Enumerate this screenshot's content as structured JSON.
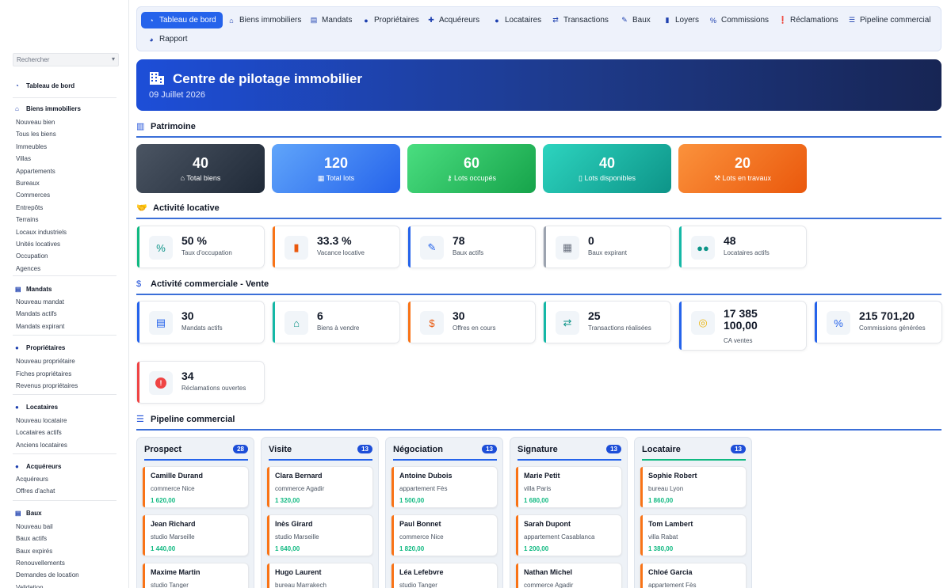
{
  "sidebar": {
    "search_placeholder": "Rechercher",
    "dashboard": "Tableau de bord",
    "groups": [
      {
        "title": "Biens immobiliers",
        "items": [
          "Nouveau bien",
          "Tous les biens",
          "Immeubles",
          "Villas",
          "Appartements",
          "Bureaux",
          "Commerces",
          "Entrepôts",
          "Terrains",
          "Locaux industriels",
          "Unités locatives",
          "Occupation",
          "Agences"
        ]
      },
      {
        "title": "Mandats",
        "items": [
          "Nouveau mandat",
          "Mandats actifs",
          "Mandats expirant"
        ]
      },
      {
        "title": "Propriétaires",
        "items": [
          "Nouveau propriétaire",
          "Fiches propriétaires",
          "Revenus propriétaires"
        ]
      },
      {
        "title": "Locataires",
        "items": [
          "Nouveau locataire",
          "Locataires actifs",
          "Anciens locataires"
        ]
      },
      {
        "title": "Acquéreurs",
        "items": [
          "Acquéreurs",
          "Offres d'achat"
        ]
      },
      {
        "title": "Baux",
        "items": [
          "Nouveau bail",
          "Baux actifs",
          "Baux expirés",
          "Renouvellements",
          "Demandes de location",
          "Validation"
        ]
      }
    ]
  },
  "nav": [
    "Tableau de bord",
    "Biens immobiliers",
    "Mandats",
    "Propriétaires",
    "Acquéreurs",
    "Locataires",
    "Transactions",
    "Baux",
    "Loyers",
    "Commissions",
    "Réclamations",
    "Pipeline commercial",
    "Rapport"
  ],
  "hero": {
    "title": "Centre de pilotage immobilier",
    "date": "09 Juillet 2026"
  },
  "sections": {
    "patrimoine": "Patrimoine",
    "locative": "Activité locative",
    "commerciale": "Activité commerciale - Vente",
    "pipeline": "Pipeline commercial"
  },
  "patrimoine": [
    {
      "value": "40",
      "label": "Total biens",
      "icon": "home-icon",
      "color": "#2d3748"
    },
    {
      "value": "120",
      "label": "Total lots",
      "icon": "grid-icon",
      "color": "#3b82f6"
    },
    {
      "value": "60",
      "label": "Lots occupés",
      "icon": "key-icon",
      "color": "#22c55e"
    },
    {
      "value": "40",
      "label": "Lots disponibles",
      "icon": "door-icon",
      "color": "#14b8a6"
    },
    {
      "value": "20",
      "label": "Lots en travaux",
      "icon": "wrench-icon",
      "color": "#f97316"
    }
  ],
  "locative": [
    {
      "value": "50 %",
      "label": "Taux d'occupation",
      "icon": "percent-icon",
      "bar": "#10b981"
    },
    {
      "value": "33.3 %",
      "label": "Vacance locative",
      "icon": "door-open-icon",
      "bar": "#f97316"
    },
    {
      "value": "78",
      "label": "Baux actifs",
      "icon": "signature-icon",
      "bar": "#2563eb"
    },
    {
      "value": "0",
      "label": "Baux expirant",
      "icon": "calendar-icon",
      "bar": "#9ca3af"
    },
    {
      "value": "48",
      "label": "Locataires actifs",
      "icon": "users-icon",
      "bar": "#14b8a6"
    }
  ],
  "commerciale": [
    {
      "value": "30",
      "label": "Mandats actifs",
      "icon": "contract-icon",
      "bar": "#2563eb"
    },
    {
      "value": "6",
      "label": "Biens à vendre",
      "icon": "house-icon",
      "bar": "#14b8a6"
    },
    {
      "value": "30",
      "label": "Offres en cours",
      "icon": "hand-money-icon",
      "bar": "#f97316"
    },
    {
      "value": "25",
      "label": "Transactions réalisées",
      "icon": "handshake-icon",
      "bar": "#14b8a6"
    },
    {
      "value": "17 385\n100,00",
      "label": "CA ventes",
      "icon": "coins-icon",
      "bar": "#2563eb"
    },
    {
      "value": "215 701,20",
      "label": "Commissions générées",
      "icon": "percent-icon",
      "bar": "#2563eb"
    },
    {
      "value": "34",
      "label": "Réclamations ouvertes",
      "icon": "alert-icon",
      "bar": "#ef4444"
    }
  ],
  "pipeline": [
    {
      "title": "Prospect",
      "count": "28",
      "underline": "#2563eb",
      "cards": [
        {
          "name": "Camille Durand",
          "desc": "commerce Nice",
          "price": "1 620,00",
          "bar": "#f97316"
        },
        {
          "name": "Jean Richard",
          "desc": "studio Marseille",
          "price": "1 440,00",
          "bar": "#f97316"
        },
        {
          "name": "Maxime Martin",
          "desc": "studio Tanger",
          "price": "",
          "bar": "#f97316"
        }
      ]
    },
    {
      "title": "Visite",
      "count": "13",
      "underline": "#2563eb",
      "cards": [
        {
          "name": "Clara Bernard",
          "desc": "commerce Agadir",
          "price": "1 320,00",
          "bar": "#f97316"
        },
        {
          "name": "Inès Girard",
          "desc": "studio Marseille",
          "price": "1 640,00",
          "bar": "#f97316"
        },
        {
          "name": "Hugo Laurent",
          "desc": "bureau Marrakech",
          "price": "",
          "bar": "#f97316"
        }
      ]
    },
    {
      "title": "Négociation",
      "count": "13",
      "underline": "#2563eb",
      "cards": [
        {
          "name": "Antoine Dubois",
          "desc": "appartement Fès",
          "price": "1 500,00",
          "bar": "#f97316"
        },
        {
          "name": "Paul Bonnet",
          "desc": "commerce Nice",
          "price": "1 820,00",
          "bar": "#f97316"
        },
        {
          "name": "Léa Lefebvre",
          "desc": "studio Tanger",
          "price": "",
          "bar": "#f97316"
        }
      ]
    },
    {
      "title": "Signature",
      "count": "13",
      "underline": "#2563eb",
      "cards": [
        {
          "name": "Marie Petit",
          "desc": "villa Paris",
          "price": "1 680,00",
          "bar": "#f97316"
        },
        {
          "name": "Sarah Dupont",
          "desc": "appartement Casablanca",
          "price": "1 200,00",
          "bar": "#f97316"
        },
        {
          "name": "Nathan Michel",
          "desc": "commerce Agadir",
          "price": "",
          "bar": "#f97316"
        }
      ]
    },
    {
      "title": "Locataire",
      "count": "13",
      "underline": "#10b981",
      "cards": [
        {
          "name": "Sophie Robert",
          "desc": "bureau Lyon",
          "price": "1 860,00",
          "bar": "#f97316"
        },
        {
          "name": "Tom Lambert",
          "desc": "villa Rabat",
          "price": "1 380,00",
          "bar": "#f97316"
        },
        {
          "name": "Chloé Garcia",
          "desc": "appartement Fès",
          "price": "",
          "bar": "#f97316"
        }
      ]
    }
  ]
}
